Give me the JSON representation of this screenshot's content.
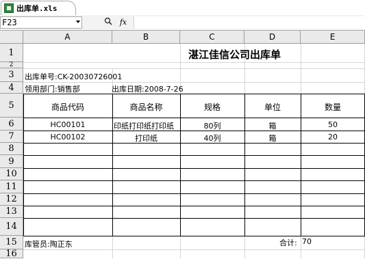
{
  "window": {
    "tab_label": "出库单.xls"
  },
  "formula_bar": {
    "name_box": "F23",
    "zoom_icon": "search-icon",
    "fx_label": "fx",
    "formula": ""
  },
  "columns": [
    "A",
    "B",
    "C",
    "D",
    "E"
  ],
  "rows": [
    "1",
    "2",
    "3",
    "4",
    "5",
    "6",
    "7",
    "8",
    "9",
    "10",
    "11",
    "12",
    "13",
    "14",
    "15",
    "16"
  ],
  "sheet": {
    "title": "湛江佳信公司出库单",
    "doc_no": "出库单号:CK-20030726001",
    "department": "领用部门:销售部",
    "date": "出库日期:2008-7-26",
    "headers": [
      "商品代码",
      "商品名称",
      "规格",
      "单位",
      "数量"
    ],
    "items": [
      {
        "code": "HC00101",
        "name": "印纸打印纸打印纸",
        "spec": "80列",
        "unit": "箱",
        "qty": "50"
      },
      {
        "code": "HC00102",
        "name": "打印纸",
        "spec": "40列",
        "unit": "箱",
        "qty": "20"
      }
    ],
    "keeper": "库管员:陶正东",
    "total_label": "合计:",
    "total_value": "70"
  }
}
